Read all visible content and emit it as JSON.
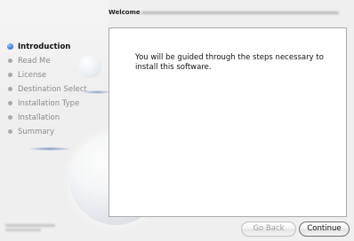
{
  "header": {
    "title": "Welcome"
  },
  "sidebar": {
    "items": [
      {
        "label": "Introduction",
        "active": true
      },
      {
        "label": "Read Me",
        "active": false
      },
      {
        "label": "License",
        "active": false
      },
      {
        "label": "Destination Select",
        "active": false
      },
      {
        "label": "Installation Type",
        "active": false
      },
      {
        "label": "Installation",
        "active": false
      },
      {
        "label": "Summary",
        "active": false
      }
    ]
  },
  "main": {
    "message": "You will be guided through the steps necessary to install this software."
  },
  "buttons": {
    "back_label": "Go Back",
    "continue_label": "Continue"
  },
  "colors": {
    "active_step_dot": "#3f7fe0",
    "panel_background": "#ffffff"
  }
}
